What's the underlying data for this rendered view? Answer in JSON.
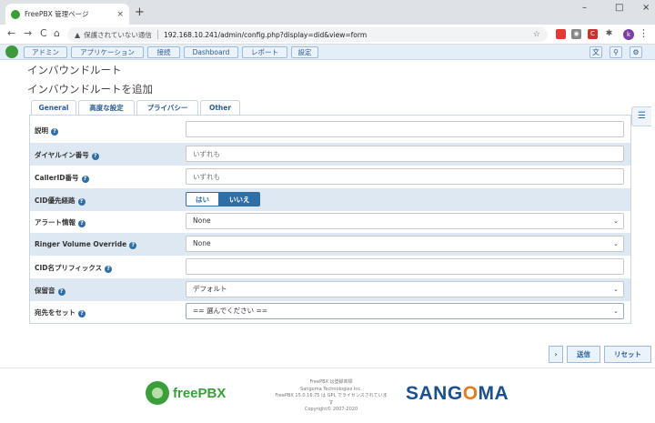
{
  "browser": {
    "tab_title": "FreePBX 管理ページ",
    "close_glyph": "×",
    "new_tab_glyph": "+",
    "window_controls": [
      "–",
      "□",
      "×"
    ],
    "nav": {
      "back": "←",
      "forward": "→",
      "reload": "C",
      "home": "⌂"
    },
    "security_label": "保護されていない通信",
    "url": "192.168.10.241/admin/config.php?display=did&view=form",
    "bookmark_glyph": "☆",
    "avatar_letter": "k",
    "menu_glyph": "⋮",
    "extensions": [
      {
        "name": "ext-red-icon",
        "glyph": "",
        "color": "#e53935"
      },
      {
        "name": "ext-camera-icon",
        "glyph": "◉",
        "color": "#777777"
      },
      {
        "name": "ext-red2-icon",
        "glyph": "C",
        "color": "#d32f2f"
      },
      {
        "name": "ext-puzzle-icon",
        "glyph": "✱",
        "color": "#555555"
      }
    ]
  },
  "topnav": {
    "items": [
      "アドミン",
      "アプリケーション",
      "接続",
      "Dashboard",
      "レポート",
      "設定"
    ],
    "icons": {
      "language": "文",
      "search": "⚲",
      "settings": "⚙"
    }
  },
  "page": {
    "title": "インバウンドルート",
    "subtitle": "インバウンドルートを追加",
    "tabs": [
      "General",
      "高度な設定",
      "プライバシー",
      "Other"
    ]
  },
  "form": {
    "help_glyph": "?",
    "rows": [
      {
        "label": "説明",
        "type": "text",
        "value": "",
        "placeholder": ""
      },
      {
        "label": "ダイヤルイン番号",
        "type": "text",
        "value": "",
        "placeholder": "いずれも"
      },
      {
        "label": "CallerID番号",
        "type": "text",
        "value": "",
        "placeholder": "いずれも"
      },
      {
        "label": "CID優先経路",
        "type": "toggle",
        "options": [
          "はい",
          "いいえ"
        ],
        "selected": "いいえ"
      },
      {
        "label": "アラート情報",
        "type": "select",
        "value": "None"
      },
      {
        "label": "Ringer Volume Override",
        "type": "select",
        "value": "None"
      },
      {
        "label": "CID名プリフィックス",
        "type": "text",
        "value": "",
        "placeholder": ""
      },
      {
        "label": "保留音",
        "type": "select",
        "value": "デフォルト"
      },
      {
        "label": "宛先をセット",
        "type": "select",
        "value": "== 選んでください =="
      }
    ],
    "select_caret": "⌄"
  },
  "side_panel_glyph": "☰",
  "actions": {
    "expand": "›",
    "submit": "送信",
    "reset": "リセット"
  },
  "footer": {
    "freepbx_logo": "freePBX",
    "credits": [
      "FreePBX は登録商標",
      "Sangoma Technologies Inc.",
      "FreePBX 15.0.16.75 は GPL でライセンスされていま",
      "す",
      "Copyright© 2007-2020"
    ],
    "sangoma_logo": [
      "SANG",
      "O",
      "MA"
    ]
  },
  "colors": {
    "accent": "#2f6fa8",
    "row_alt": "#dde8f3",
    "nav_bg": "#e4eef8"
  }
}
